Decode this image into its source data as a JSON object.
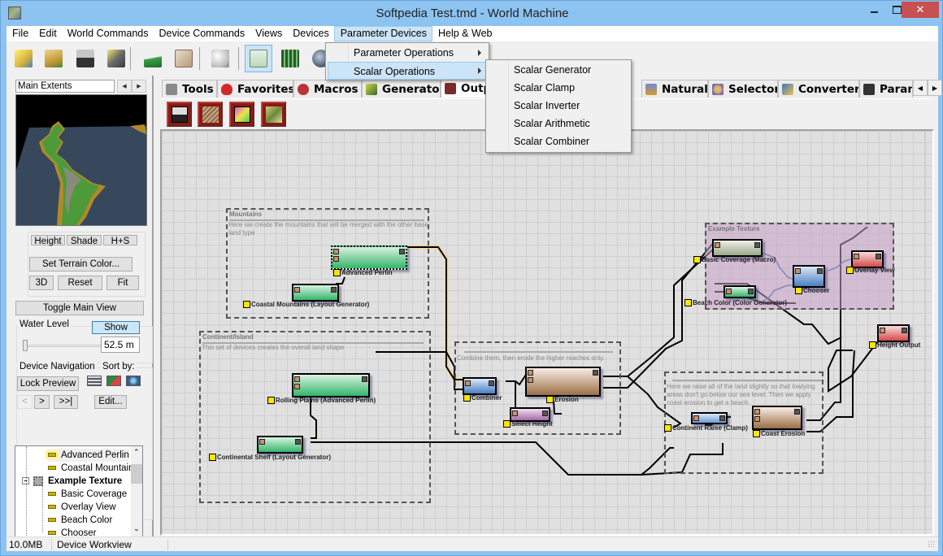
{
  "window": {
    "title": "Softpedia Test.tmd - World Machine",
    "controls": {
      "close": "✕"
    }
  },
  "menubar": {
    "items": [
      "File",
      "Edit",
      "World Commands",
      "Device Commands",
      "Views",
      "Devices",
      "Parameter Devices",
      "Help & Web"
    ],
    "active": "Parameter Devices"
  },
  "menu_parameter_devices": {
    "items": [
      {
        "label": "Parameter Operations",
        "has_submenu": true
      },
      {
        "label": "Scalar Operations",
        "has_submenu": true,
        "highlighted": true
      }
    ]
  },
  "submenu_scalar_operations": {
    "items": [
      "Scalar Generator",
      "Scalar Clamp",
      "Scalar Inverter",
      "Scalar Arithmetic",
      "Scalar Combiner"
    ]
  },
  "toolbar": {
    "buttons": [
      "new-world-icon",
      "open-icon",
      "save-icon",
      "export-icon",
      "heightfield-icon",
      "checklist-icon",
      "dice-icon",
      "device-workview-icon",
      "layout-view-icon",
      "globe-icon"
    ]
  },
  "left_panel": {
    "extents_label": "Main Extents",
    "view_buttons": [
      "Height",
      "Shade",
      "H+S"
    ],
    "set_terrain_color": "Set Terrain Color...",
    "camera_buttons": [
      "3D",
      "Reset",
      "Fit"
    ],
    "toggle_main_view": "Toggle Main View",
    "water_level": {
      "label": "Water Level",
      "show_label": "Show",
      "value": "52.5 m",
      "slider_fraction": 0.0
    },
    "device_navigation": {
      "label": "Device Navigation",
      "sort_by": "Sort by:",
      "lock_preview": "Lock Preview",
      "nav_prev": "<",
      "nav_next": ">",
      "nav_last": ">>|",
      "edit": "Edit..."
    },
    "tree": [
      {
        "label": "Advanced Perlin",
        "level": 2,
        "selected": true
      },
      {
        "label": "Coastal Mountains",
        "level": 2
      },
      {
        "label": "Example Texture",
        "level": 1,
        "bold": true,
        "expanded": true
      },
      {
        "label": "Basic Coverage",
        "level": 2
      },
      {
        "label": "Overlay View",
        "level": 2
      },
      {
        "label": "Beach Color",
        "level": 2
      },
      {
        "label": "Chooser",
        "level": 2
      }
    ]
  },
  "tabs": {
    "items": [
      {
        "label": "Tools",
        "icon": "tools-icon",
        "color": "#8a8a8a"
      },
      {
        "label": "Favorites",
        "icon": "heart-icon",
        "color": "#d12a2a"
      },
      {
        "label": "Macros",
        "icon": "macros-icon",
        "color": "#b33"
      },
      {
        "label": "Generator",
        "icon": "generator-icon",
        "color": "#6a8a2a"
      },
      {
        "label": "Output",
        "icon": "output-icon",
        "color": "#7a2a2a",
        "active": true
      },
      {
        "label": "Natural",
        "icon": "natural-icon",
        "color": "#d89a2a"
      },
      {
        "label": "Selector",
        "icon": "selector-icon",
        "color": "#7a6aa8"
      },
      {
        "label": "Converter",
        "icon": "converter-icon",
        "color": "#3a7ac8"
      },
      {
        "label": "Param",
        "icon": "param-icon",
        "color": "#333"
      }
    ]
  },
  "palette": {
    "devices": [
      "height-output-icon",
      "mesh-output-icon",
      "bitmap-output-icon",
      "terrain-output-icon"
    ]
  },
  "workview": {
    "groups": [
      {
        "title": "Mountains",
        "description": "Here we create the mountains that will be merged with the other base land type"
      },
      {
        "title": "Continent/Island",
        "description": "This set of devices creates the overall land shape"
      },
      {
        "title": "",
        "description": "Combine them, then erode the higher reaches only."
      },
      {
        "title": "Example Texture",
        "description": ""
      },
      {
        "title": "",
        "description": "Here we raise all of the land slightly so that lowlying areas don't go below our sea level. Then we apply coast erosion to get a beach."
      }
    ],
    "nodes": [
      {
        "label": "Advanced Perlin",
        "color_top": "#d9f2e2",
        "color_bottom": "#34b56a"
      },
      {
        "label": "Coastal Mountains (Layout Generator)",
        "color_top": "#d9f2e2",
        "color_bottom": "#34b56a"
      },
      {
        "label": "Rolling Plains (Advanced Perlin)",
        "color_top": "#d9f2e2",
        "color_bottom": "#34b56a"
      },
      {
        "label": "Continental Shelf (Layout Generator)",
        "color_top": "#d9f2e2",
        "color_bottom": "#34b56a"
      },
      {
        "label": "Combiner",
        "color_top": "#dbe8f7",
        "color_bottom": "#4a7fc1"
      },
      {
        "label": "Erosion",
        "color_top": "#f8ece4",
        "color_bottom": "#9a7046"
      },
      {
        "label": "Select Height",
        "color_top": "#f2dcef",
        "color_bottom": "#a66aa6"
      },
      {
        "label": "Basic Coverage (Macro)",
        "color_top": "#eef0e8",
        "color_bottom": "#9aa88a"
      },
      {
        "label": "Beach Color (Color Generator)",
        "color_top": "#d9f2e2",
        "color_bottom": "#34b56a"
      },
      {
        "label": "Chooser",
        "color_top": "#dbe8f7",
        "color_bottom": "#4a7fc1"
      },
      {
        "label": "Overlay View",
        "color_top": "#f7dcdc",
        "color_bottom": "#d44a4a"
      },
      {
        "label": "Height Output",
        "color_top": "#f7dcdc",
        "color_bottom": "#d44a4a"
      },
      {
        "label": "Continent Raise (Clamp)",
        "color_top": "#dbe8f7",
        "color_bottom": "#6a9ad6"
      },
      {
        "label": "Coast Erosion",
        "color_top": "#f8ece4",
        "color_bottom": "#9a7046"
      }
    ]
  },
  "statusbar": {
    "memory": "10.0MB",
    "view": "Device Workview"
  }
}
